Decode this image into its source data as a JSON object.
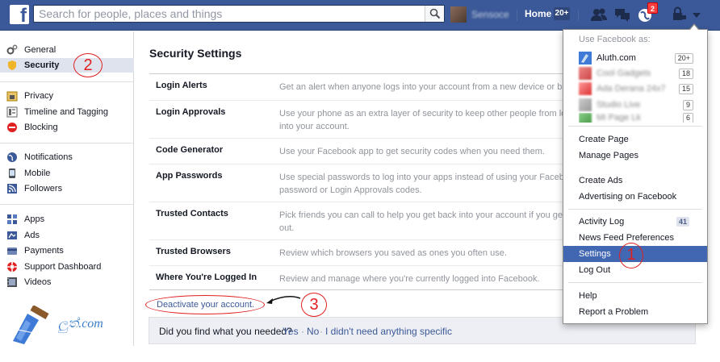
{
  "topbar": {
    "logo_letter": "f",
    "search_placeholder": "Search for people, places and things",
    "profile_name": "Sensoce",
    "home_label": "Home",
    "home_count": "20+",
    "notifications_count": "2"
  },
  "sidebar": {
    "items": [
      {
        "label": "General",
        "icon": "gears-icon"
      },
      {
        "label": "Security",
        "icon": "shield-icon"
      },
      {
        "label": "Privacy",
        "icon": "lock-icon"
      },
      {
        "label": "Timeline and Tagging",
        "icon": "timeline-icon"
      },
      {
        "label": "Blocking",
        "icon": "block-icon"
      },
      {
        "label": "Notifications",
        "icon": "globe-icon"
      },
      {
        "label": "Mobile",
        "icon": "phone-icon"
      },
      {
        "label": "Followers",
        "icon": "rss-icon"
      },
      {
        "label": "Apps",
        "icon": "apps-icon"
      },
      {
        "label": "Ads",
        "icon": "ads-icon"
      },
      {
        "label": "Payments",
        "icon": "credit-card-icon"
      },
      {
        "label": "Support Dashboard",
        "icon": "lifebuoy-icon"
      },
      {
        "label": "Videos",
        "icon": "film-icon"
      }
    ],
    "watermark": "ලුත්.com"
  },
  "main": {
    "title": "Security Settings",
    "rows": [
      {
        "label": "Login Alerts",
        "desc1": "Get an alert when anyone logs into your account from a new device or b",
        "desc2": ""
      },
      {
        "label": "Login Approvals",
        "desc1": "Use your phone as an extra layer of security to keep other people from lo",
        "desc2": "into your account."
      },
      {
        "label": "Code Generator",
        "desc1": "Use your Facebook app to get security codes when you need them.",
        "desc2": ""
      },
      {
        "label": "App Passwords",
        "desc1": "Use special passwords to log into your apps instead of using your Faceb",
        "desc2": "password or Login Approvals codes."
      },
      {
        "label": "Trusted Contacts",
        "desc1": "Pick friends you can call to help you get back into your account if you ge",
        "desc2": "out."
      },
      {
        "label": "Trusted Browsers",
        "desc1": "Review which browsers you saved as ones you often use.",
        "desc2": ""
      },
      {
        "label": "Where You're Logged In",
        "desc1": "Review and manage where you're currently logged into Facebook.",
        "desc2": ""
      }
    ],
    "deactivate": "Deactivate your account.",
    "feedback_question": "Did you find what you needed?",
    "feedback_yes": "Yes",
    "feedback_no": "No",
    "feedback_skip": "I didn't need anything specific",
    "feedback_sep": "·"
  },
  "dropdown": {
    "header": "Use Facebook as:",
    "accounts": [
      {
        "name": "Aluth.com",
        "count": "20+"
      },
      {
        "name": "Cool Gadgets",
        "count": "18"
      },
      {
        "name": "Ada Derana 24x7",
        "count": "15"
      },
      {
        "name": "Studio Live",
        "count": "9"
      },
      {
        "name": "Mi Page Lk",
        "count": "6"
      }
    ],
    "group1": [
      "Create Page",
      "Manage Pages"
    ],
    "group2": [
      "Create Ads",
      "Advertising on Facebook"
    ],
    "group3": [
      "Activity Log",
      "News Feed Preferences",
      "Settings",
      "Log Out"
    ],
    "activity_count": "41",
    "group4": [
      "Help",
      "Report a Problem"
    ]
  },
  "annotations": {
    "one": "1",
    "two": "2",
    "three": "3"
  },
  "colors": {
    "brand": "#3b5998",
    "highlight": "#4267b2",
    "annotation": "#e02020"
  }
}
